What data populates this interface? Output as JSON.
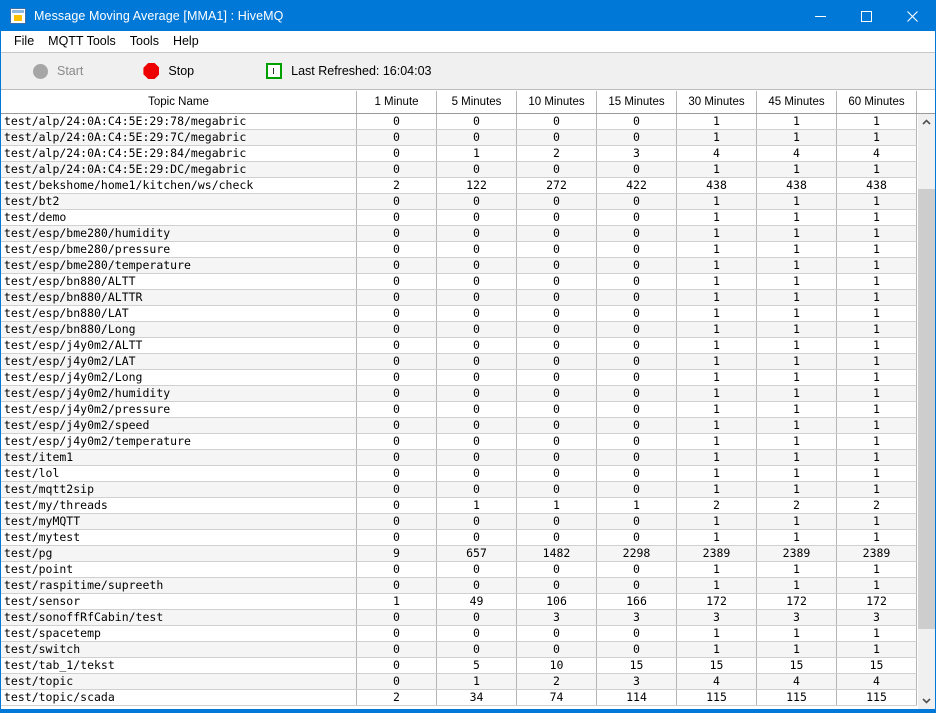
{
  "window": {
    "title": "Message Moving Average [MMA1] : HiveMQ",
    "app_icon": "table-grid-icon",
    "titlebar_color": "#0078d7",
    "minimize_label": "–",
    "maximize_label": "☐",
    "close_label": "✕"
  },
  "menu": {
    "items": [
      {
        "label": "File"
      },
      {
        "label": "MQTT Tools"
      },
      {
        "label": "Tools"
      },
      {
        "label": "Help"
      }
    ]
  },
  "toolbar": {
    "start_label": "Start",
    "start_icon": "gray-circle-icon",
    "start_enabled": false,
    "stop_label": "Stop",
    "stop_icon": "red-octagon-stop-icon",
    "stop_enabled": true,
    "refresh_icon": "green-clock-icon",
    "last_refreshed_label": "Last Refreshed: 16:04:03",
    "accent_red": "#ee0000",
    "accent_green": "#00a000",
    "disabled_gray": "#a6a6a6"
  },
  "table": {
    "columns": [
      "Topic Name",
      "1 Minute",
      "5 Minutes",
      "10 Minutes",
      "15 Minutes",
      "30 Minutes",
      "45 Minutes",
      "60 Minutes"
    ],
    "rows": [
      {
        "topic": "test/alp/24:0A:C4:5E:29:78/megabric",
        "values": [
          "0",
          "0",
          "0",
          "0",
          "1",
          "1",
          "1"
        ]
      },
      {
        "topic": "test/alp/24:0A:C4:5E:29:7C/megabric",
        "values": [
          "0",
          "0",
          "0",
          "0",
          "1",
          "1",
          "1"
        ]
      },
      {
        "topic": "test/alp/24:0A:C4:5E:29:84/megabric",
        "values": [
          "0",
          "1",
          "2",
          "3",
          "4",
          "4",
          "4"
        ]
      },
      {
        "topic": "test/alp/24:0A:C4:5E:29:DC/megabric",
        "values": [
          "0",
          "0",
          "0",
          "0",
          "1",
          "1",
          "1"
        ]
      },
      {
        "topic": "test/bekshome/home1/kitchen/ws/check",
        "values": [
          "2",
          "122",
          "272",
          "422",
          "438",
          "438",
          "438"
        ]
      },
      {
        "topic": "test/bt2",
        "values": [
          "0",
          "0",
          "0",
          "0",
          "1",
          "1",
          "1"
        ]
      },
      {
        "topic": "test/demo",
        "values": [
          "0",
          "0",
          "0",
          "0",
          "1",
          "1",
          "1"
        ]
      },
      {
        "topic": "test/esp/bme280/humidity",
        "values": [
          "0",
          "0",
          "0",
          "0",
          "1",
          "1",
          "1"
        ]
      },
      {
        "topic": "test/esp/bme280/pressure",
        "values": [
          "0",
          "0",
          "0",
          "0",
          "1",
          "1",
          "1"
        ]
      },
      {
        "topic": "test/esp/bme280/temperature",
        "values": [
          "0",
          "0",
          "0",
          "0",
          "1",
          "1",
          "1"
        ]
      },
      {
        "topic": "test/esp/bn880/ALTT",
        "values": [
          "0",
          "0",
          "0",
          "0",
          "1",
          "1",
          "1"
        ]
      },
      {
        "topic": "test/esp/bn880/ALTTR",
        "values": [
          "0",
          "0",
          "0",
          "0",
          "1",
          "1",
          "1"
        ]
      },
      {
        "topic": "test/esp/bn880/LAT",
        "values": [
          "0",
          "0",
          "0",
          "0",
          "1",
          "1",
          "1"
        ]
      },
      {
        "topic": "test/esp/bn880/Long",
        "values": [
          "0",
          "0",
          "0",
          "0",
          "1",
          "1",
          "1"
        ]
      },
      {
        "topic": "test/esp/j4y0m2/ALTT",
        "values": [
          "0",
          "0",
          "0",
          "0",
          "1",
          "1",
          "1"
        ]
      },
      {
        "topic": "test/esp/j4y0m2/LAT",
        "values": [
          "0",
          "0",
          "0",
          "0",
          "1",
          "1",
          "1"
        ]
      },
      {
        "topic": "test/esp/j4y0m2/Long",
        "values": [
          "0",
          "0",
          "0",
          "0",
          "1",
          "1",
          "1"
        ]
      },
      {
        "topic": "test/esp/j4y0m2/humidity",
        "values": [
          "0",
          "0",
          "0",
          "0",
          "1",
          "1",
          "1"
        ]
      },
      {
        "topic": "test/esp/j4y0m2/pressure",
        "values": [
          "0",
          "0",
          "0",
          "0",
          "1",
          "1",
          "1"
        ]
      },
      {
        "topic": "test/esp/j4y0m2/speed",
        "values": [
          "0",
          "0",
          "0",
          "0",
          "1",
          "1",
          "1"
        ]
      },
      {
        "topic": "test/esp/j4y0m2/temperature",
        "values": [
          "0",
          "0",
          "0",
          "0",
          "1",
          "1",
          "1"
        ]
      },
      {
        "topic": "test/item1",
        "values": [
          "0",
          "0",
          "0",
          "0",
          "1",
          "1",
          "1"
        ]
      },
      {
        "topic": "test/lol",
        "values": [
          "0",
          "0",
          "0",
          "0",
          "1",
          "1",
          "1"
        ]
      },
      {
        "topic": "test/mqtt2sip",
        "values": [
          "0",
          "0",
          "0",
          "0",
          "1",
          "1",
          "1"
        ]
      },
      {
        "topic": "test/my/threads",
        "values": [
          "0",
          "1",
          "1",
          "1",
          "2",
          "2",
          "2"
        ]
      },
      {
        "topic": "test/myMQTT",
        "values": [
          "0",
          "0",
          "0",
          "0",
          "1",
          "1",
          "1"
        ]
      },
      {
        "topic": "test/mytest",
        "values": [
          "0",
          "0",
          "0",
          "0",
          "1",
          "1",
          "1"
        ]
      },
      {
        "topic": "test/pg",
        "values": [
          "9",
          "657",
          "1482",
          "2298",
          "2389",
          "2389",
          "2389"
        ]
      },
      {
        "topic": "test/point",
        "values": [
          "0",
          "0",
          "0",
          "0",
          "1",
          "1",
          "1"
        ]
      },
      {
        "topic": "test/raspitime/supreeth",
        "values": [
          "0",
          "0",
          "0",
          "0",
          "1",
          "1",
          "1"
        ]
      },
      {
        "topic": "test/sensor",
        "values": [
          "1",
          "49",
          "106",
          "166",
          "172",
          "172",
          "172"
        ]
      },
      {
        "topic": "test/sonoffRfCabin/test",
        "values": [
          "0",
          "0",
          "3",
          "3",
          "3",
          "3",
          "3"
        ]
      },
      {
        "topic": "test/spacetemp",
        "values": [
          "0",
          "0",
          "0",
          "0",
          "1",
          "1",
          "1"
        ]
      },
      {
        "topic": "test/switch",
        "values": [
          "0",
          "0",
          "0",
          "0",
          "1",
          "1",
          "1"
        ]
      },
      {
        "topic": "test/tab_1/tekst",
        "values": [
          "0",
          "5",
          "10",
          "15",
          "15",
          "15",
          "15"
        ]
      },
      {
        "topic": "test/topic",
        "values": [
          "0",
          "1",
          "2",
          "3",
          "4",
          "4",
          "4"
        ]
      },
      {
        "topic": "test/topic/scada",
        "values": [
          "2",
          "34",
          "74",
          "114",
          "115",
          "115",
          "115"
        ]
      }
    ]
  },
  "scrollbar": {
    "up_arrow": "▲",
    "down_arrow": "▼"
  }
}
